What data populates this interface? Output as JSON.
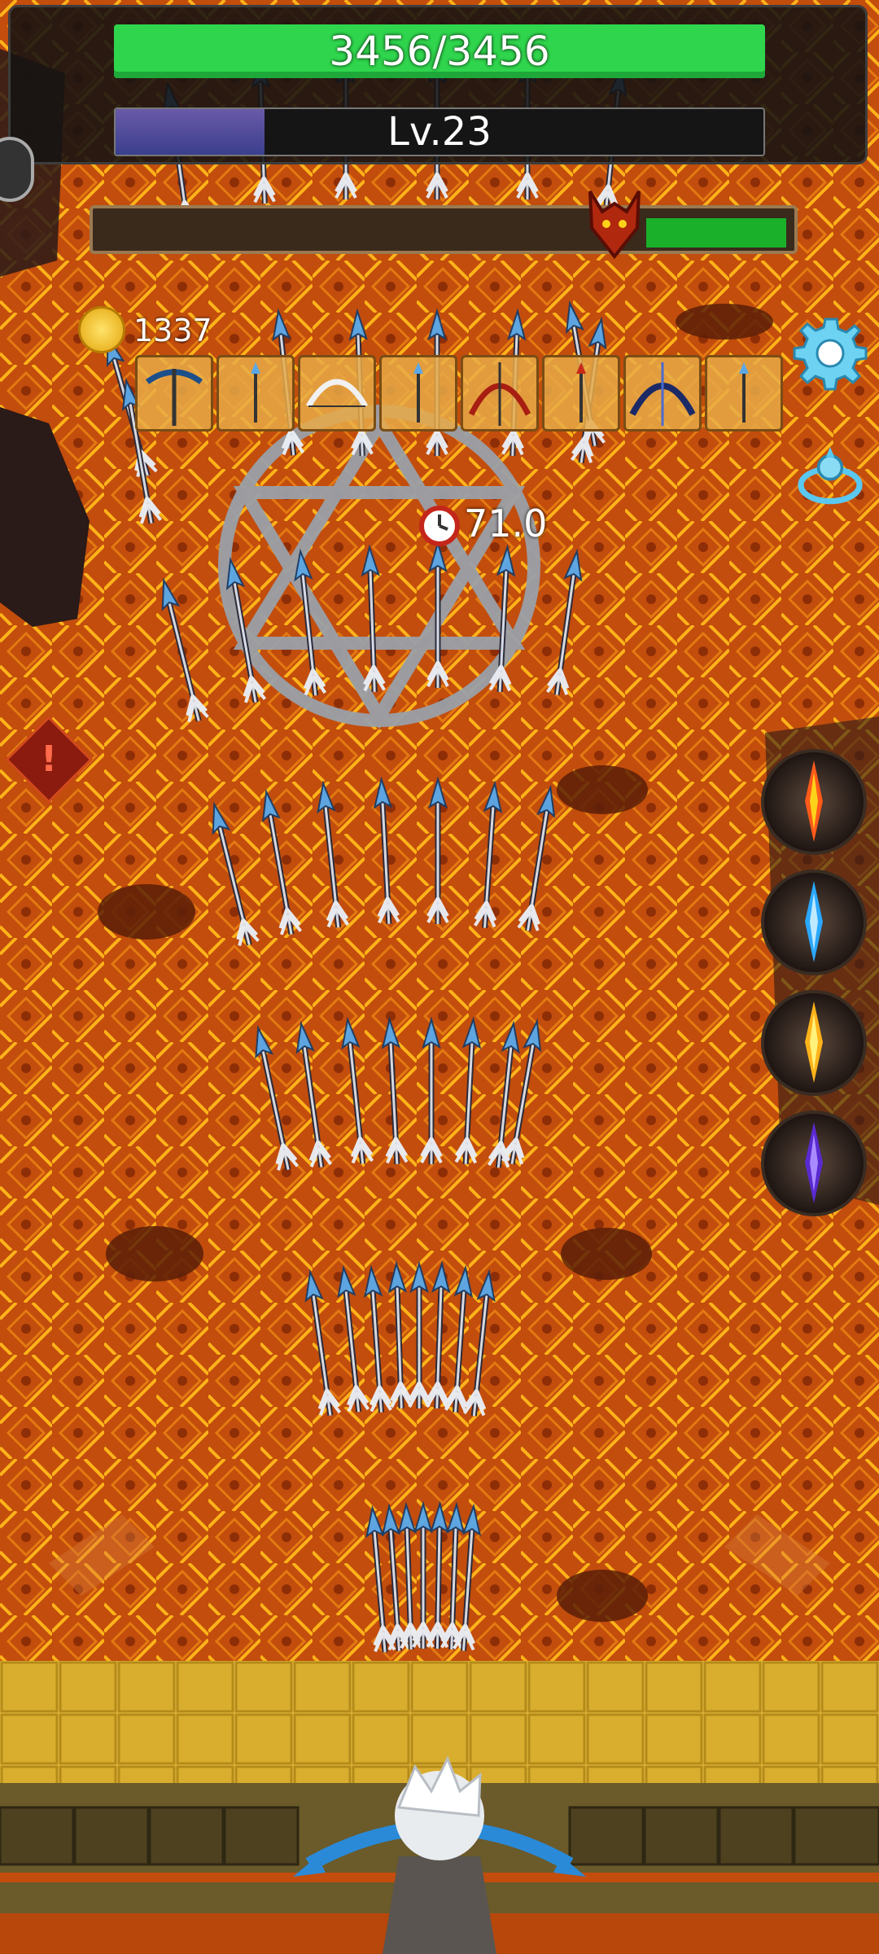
{
  "hud": {
    "hp_text": "3456/3456",
    "hp_fraction": 1.0,
    "level_text": "Lv.23",
    "xp_fraction": 0.23
  },
  "boss": {
    "health_fraction": 0.2
  },
  "currency": {
    "coins": "1337"
  },
  "timer": {
    "value": "71.0"
  },
  "weapon_slots": [
    {
      "name": "crossbow-blue-icon"
    },
    {
      "name": "arrow-icon"
    },
    {
      "name": "bow-white-icon"
    },
    {
      "name": "arrow-icon"
    },
    {
      "name": "bow-red-icon"
    },
    {
      "name": "arrow-red-icon"
    },
    {
      "name": "bow-dark-blue-icon"
    },
    {
      "name": "arrow-icon"
    }
  ],
  "skills": [
    {
      "name": "fire-arrow-skill",
      "color": "#ff5a1a"
    },
    {
      "name": "ice-arrow-skill",
      "color": "#2aa8ff"
    },
    {
      "name": "lightning-arrow-skill",
      "color": "#ffd21a"
    },
    {
      "name": "shadow-arrow-skill",
      "color": "#7b3cff"
    }
  ],
  "colors": {
    "lava": "#c9520f",
    "hp_green": "#2fd64d",
    "xp_purple": "#5b4fa0",
    "arrow_tip": "#5aa8e8"
  }
}
